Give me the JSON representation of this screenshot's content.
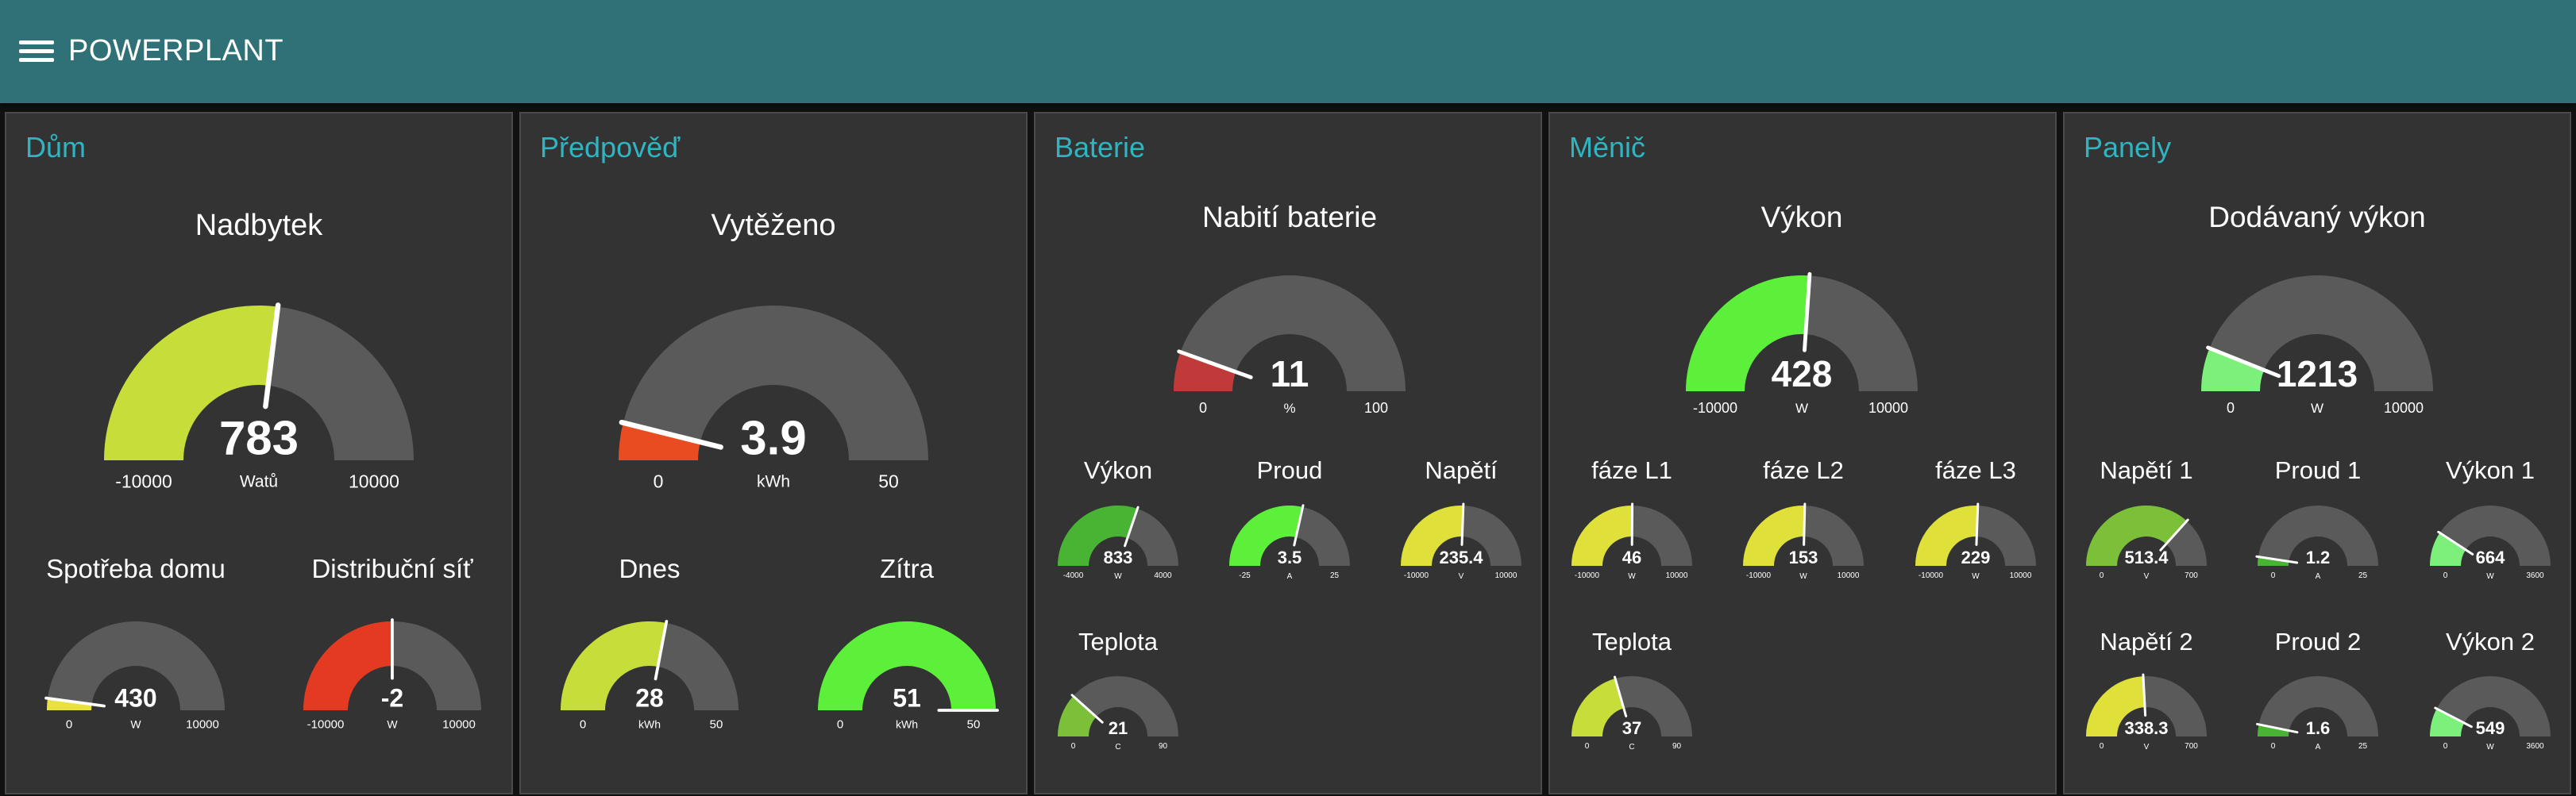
{
  "app": {
    "title": "POWERPLANT"
  },
  "colors": {
    "header": "#2f7177",
    "panel": "#333333",
    "group_title": "#2fb5c1",
    "track": "#5a5a5a"
  },
  "icons": {
    "menu": "hamburger-menu-icon"
  },
  "groups": [
    {
      "title": "Dům",
      "gauges": [
        {
          "label": "Nadbytek",
          "value": 783,
          "display": "783",
          "unit": "Watů",
          "min": -10000,
          "max": 10000,
          "min_label": "-10000",
          "max_label": "10000",
          "color": "#c7dd3a"
        },
        {
          "label": "Spotřeba domu",
          "value": 430,
          "display": "430",
          "unit": "W",
          "min": 0,
          "max": 10000,
          "min_label": "0",
          "max_label": "10000",
          "color": "#e8e23a"
        },
        {
          "label": "Distribuční síť",
          "value": -2,
          "display": "-2",
          "unit": "W",
          "min": -10000,
          "max": 10000,
          "min_label": "-10000",
          "max_label": "10000",
          "color": "#e53a22"
        }
      ]
    },
    {
      "title": "Předpověď",
      "gauges": [
        {
          "label": "Vytěženo",
          "value": 3.9,
          "display": "3.9",
          "unit": "kWh",
          "min": 0,
          "max": 50,
          "min_label": "0",
          "max_label": "50",
          "color": "#ea4c22"
        },
        {
          "label": "Dnes",
          "value": 28,
          "display": "28",
          "unit": "kWh",
          "min": 0,
          "max": 50,
          "min_label": "0",
          "max_label": "50",
          "color": "#c7dd3a"
        },
        {
          "label": "Zítra",
          "value": 51,
          "display": "51",
          "unit": "kWh",
          "min": 0,
          "max": 50,
          "min_label": "0",
          "max_label": "50",
          "color": "#5cf03a"
        }
      ]
    },
    {
      "title": "Baterie",
      "gauges": [
        {
          "label": "Nabití baterie",
          "value": 11,
          "display": "11",
          "unit": "%",
          "min": 0,
          "max": 100,
          "min_label": "0",
          "max_label": "100",
          "color": "#c03a3a"
        },
        {
          "label": "Výkon",
          "value": 833,
          "display": "833",
          "unit": "W",
          "min": -4000,
          "max": 4000,
          "min_label": "-4000",
          "max_label": "4000",
          "color": "#49b334"
        },
        {
          "label": "Proud",
          "value": 3.5,
          "display": "3.5",
          "unit": "A",
          "min": -25,
          "max": 25,
          "min_label": "-25",
          "max_label": "25",
          "color": "#5cf03a"
        },
        {
          "label": "Napětí",
          "value": 235.4,
          "display": "235.4",
          "unit": "V",
          "min": -10000,
          "max": 10000,
          "min_label": "-10000",
          "max_label": "10000",
          "color": "#e0e03a"
        },
        {
          "label": "Teplota",
          "value": 21,
          "display": "21",
          "unit": "C",
          "min": 0,
          "max": 90,
          "min_label": "0",
          "max_label": "90",
          "color": "#7cc03a"
        }
      ]
    },
    {
      "title": "Měnič",
      "gauges": [
        {
          "label": "Výkon",
          "value": 428,
          "display": "428",
          "unit": "W",
          "min": -10000,
          "max": 10000,
          "min_label": "-10000",
          "max_label": "10000",
          "color": "#5cf03a"
        },
        {
          "label": "fáze L1",
          "value": 46,
          "display": "46",
          "unit": "W",
          "min": -10000,
          "max": 10000,
          "min_label": "-10000",
          "max_label": "10000",
          "color": "#e0e03a"
        },
        {
          "label": "fáze L2",
          "value": 153,
          "display": "153",
          "unit": "W",
          "min": -10000,
          "max": 10000,
          "min_label": "-10000",
          "max_label": "10000",
          "color": "#e0e03a"
        },
        {
          "label": "fáze L3",
          "value": 229,
          "display": "229",
          "unit": "W",
          "min": -10000,
          "max": 10000,
          "min_label": "-10000",
          "max_label": "10000",
          "color": "#e0e03a"
        },
        {
          "label": "Teplota",
          "value": 37,
          "display": "37",
          "unit": "C",
          "min": 0,
          "max": 90,
          "min_label": "0",
          "max_label": "90",
          "color": "#c7dd3a"
        }
      ]
    },
    {
      "title": "Panely",
      "gauges": [
        {
          "label": "Dodávaný výkon",
          "value": 1213,
          "display": "1213",
          "unit": "W",
          "min": 0,
          "max": 10000,
          "min_label": "0",
          "max_label": "10000",
          "color": "#7cf07a"
        },
        {
          "label": "Napětí 1",
          "value": 513.4,
          "display": "513.4",
          "unit": "V",
          "min": 0,
          "max": 700,
          "min_label": "0",
          "max_label": "700",
          "color": "#7cc03a"
        },
        {
          "label": "Proud 1",
          "value": 1.2,
          "display": "1.2",
          "unit": "A",
          "min": 0,
          "max": 25,
          "min_label": "0",
          "max_label": "25",
          "color": "#49b334"
        },
        {
          "label": "Výkon 1",
          "value": 664,
          "display": "664",
          "unit": "W",
          "min": 0,
          "max": 3600,
          "min_label": "0",
          "max_label": "3600",
          "color": "#7cf07a"
        },
        {
          "label": "Napětí 2",
          "value": 338.3,
          "display": "338.3",
          "unit": "V",
          "min": 0,
          "max": 700,
          "min_label": "0",
          "max_label": "700",
          "color": "#e0e03a"
        },
        {
          "label": "Proud 2",
          "value": 1.6,
          "display": "1.6",
          "unit": "A",
          "min": 0,
          "max": 25,
          "min_label": "0",
          "max_label": "25",
          "color": "#49b334"
        },
        {
          "label": "Výkon 2",
          "value": 549,
          "display": "549",
          "unit": "W",
          "min": 0,
          "max": 3600,
          "min_label": "0",
          "max_label": "3600",
          "color": "#7cf07a"
        }
      ]
    }
  ]
}
